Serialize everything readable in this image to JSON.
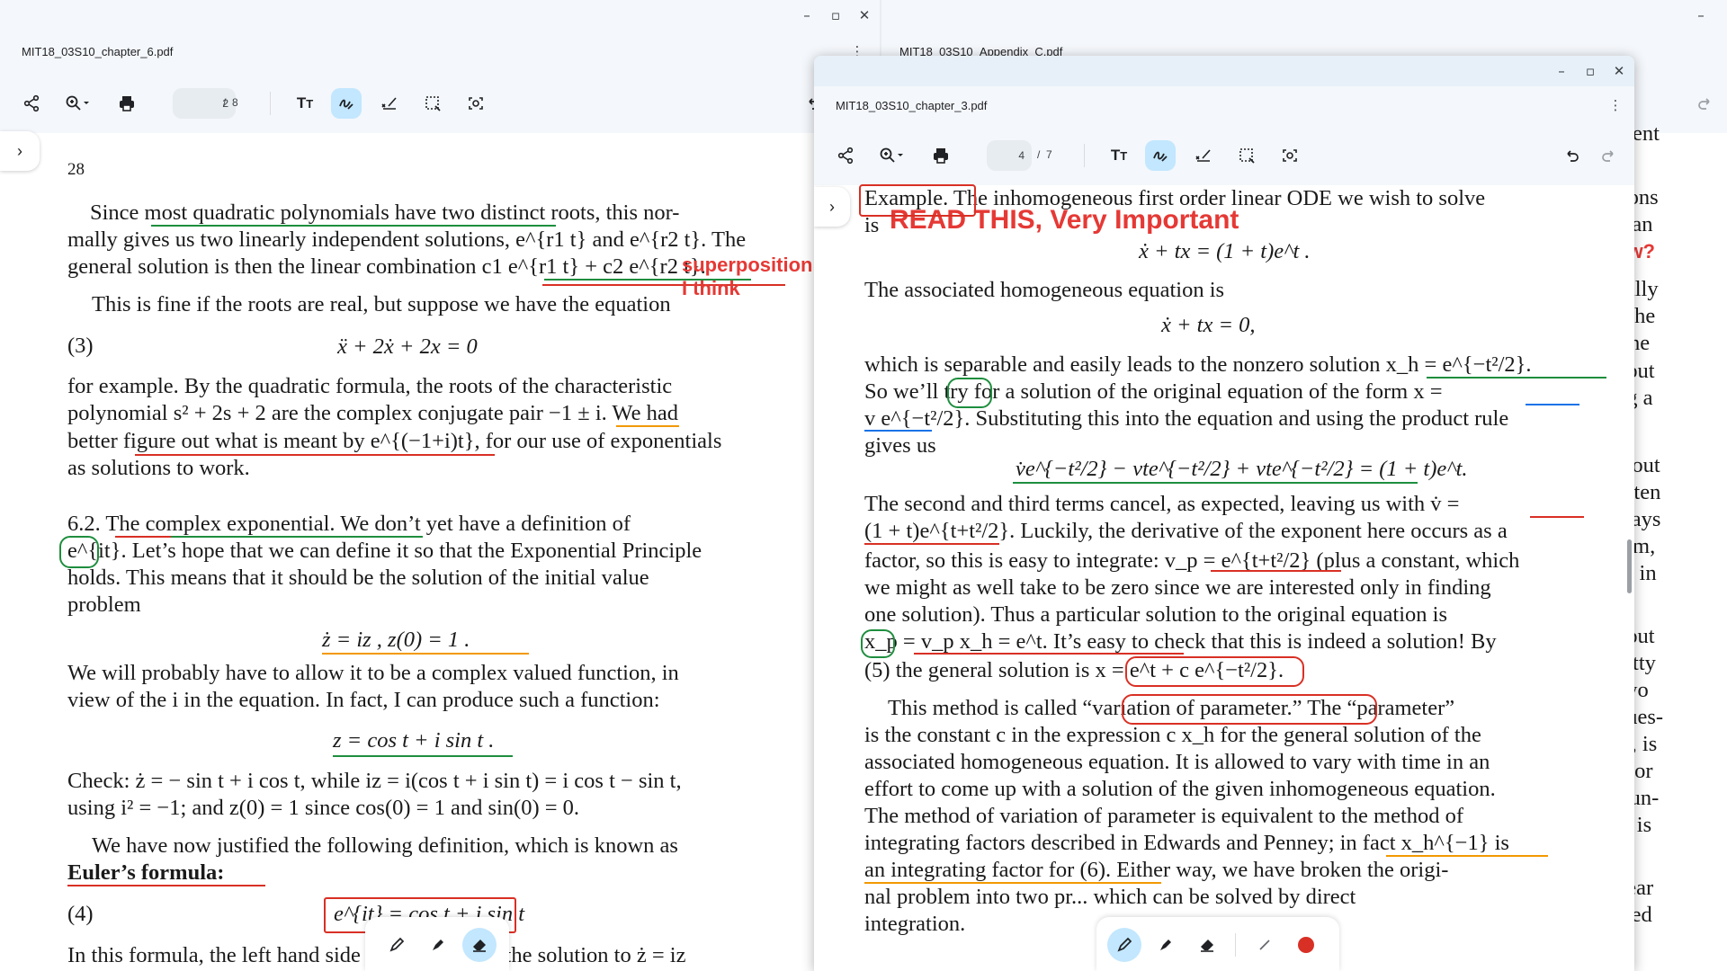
{
  "left_window": {
    "filename": "MIT18_03S10_chapter_6.pdf",
    "page_current": "2",
    "page_sep": "/",
    "page_total": "8",
    "page_number_printed": "28",
    "lines": [
      "Since most quadratic polynomials have two distinct roots, this nor-",
      "mally gives us two linearly independent solutions, e^{r1 t} and e^{r2 t}. The",
      "general solution is then the linear combination c1 e^{r1 t} + c2 e^{r2 t}.",
      "This is fine if the roots are real, but suppose we have the equation",
      "for example. By the quadratic formula, the roots of the characteristic",
      "polynomial s² + 2s + 2 are the complex conjugate pair −1 ± i. We had",
      "better figure out what is meant by e^{(−1+i)t}, for our use of exponentials",
      "as solutions to work.",
      "6.2. The complex exponential. We don’t yet have a definition of",
      "e^{it}. Let’s hope that we can define it so that the Exponential Principle",
      "holds. This means that it should be the solution of the initial value",
      "problem",
      "We will probably have to allow it to be a complex valued function, in",
      "view of the i in the equation. In fact, I can produce such a function:",
      "Check: ż = − sin t + i cos t, while iz = i(cos t + i sin t) = i cos t − sin t,",
      "using i² = −1; and z(0) = 1 since cos(0) = 1 and sin(0) = 0.",
      "We have now justified the following definition, which is known as",
      "Euler’s formula:",
      "In this formula, the left hand side is by definition the solution to ż = iz"
    ],
    "eq3_label": "(3)",
    "eq3": "ẍ + 2ẋ + 2x = 0",
    "eq_ivp": "ż = iz ,    z(0) = 1 .",
    "eq_z": "z = cos t + i sin t .",
    "eq4_label": "(4)",
    "eq4": "e^{it} = cos t + i sin t",
    "annotation_1": "superposition",
    "annotation_2": "I think"
  },
  "right_back_window": {
    "filename": "MIT18_03S10_Appendix_C.pdf",
    "edge_text": [
      "erent",
      "tions",
      "g an",
      "ow?",
      "cally",
      "f the",
      "The",
      "hout",
      "ng a",
      "k out",
      "often",
      "ways",
      "ium,",
      "as in",
      "bout",
      "retty",
      "two",
      "ques-",
      "le, is",
      "t) or",
      "s un-",
      "at is",
      "near",
      "ated"
    ]
  },
  "front_window": {
    "filename": "MIT18_03S10_chapter_3.pdf",
    "page_current": "4",
    "page_sep": "/",
    "page_total": "7",
    "annotation_read": "READ THIS, Very Important",
    "lines": [
      "Example. The inhomogeneous first order linear ODE we wish to solve",
      "is",
      "The associated homogeneous equation is",
      "which is separable and easily leads to the nonzero solution x_h = e^{−t²/2}.",
      "So we’ll try for a solution of the original equation of the form x =",
      "v e^{−t²/2}. Substituting this into the equation and using the product rule",
      "gives us",
      "The second and third terms cancel, as expected, leaving us with v̇ =",
      "(1 + t)e^{t+t²/2}. Luckily, the derivative of the exponent here occurs as a",
      "factor, so this is easy to integrate: v_p = e^{t+t²/2} (plus a constant, which",
      "we might as well take to be zero since we are interested only in finding",
      "one solution). Thus a particular solution to the original equation is",
      "x_p = v_p x_h = e^t. It’s easy to check that this is indeed a solution! By",
      "(5) the general solution is x = e^t + c e^{−t²/2}.",
      "This method is called “variation of parameter.” The “parameter”",
      "is the constant c in the expression c x_h for the general solution of the",
      "associated homogeneous equation. It is allowed to vary with time in an",
      "effort to come up with a solution of the given inhomogeneous equation.",
      "The method of variation of parameter is equivalent to the method of",
      "integrating factors described in Edwards and Penney; in fact x_h^{−1} is",
      "an integrating factor for (6). Either way, we have broken the origi-",
      "nal problem into two pr... which can be solved by direct",
      "integration."
    ],
    "eq_inhom": "ẋ + tx = (1 + t)e^t .",
    "eq_hom": "ẋ + tx = 0,",
    "eq_prod": "v̇e^{−t²/2} − vte^{−t²/2} + vte^{−t²/2} = (1 + t)e^t."
  },
  "colors": {
    "pen_red": "#d93025",
    "pen_green": "#1e8e3e",
    "pen_orange": "#f29900",
    "pen_blue": "#1a73e8",
    "active_tool": "#c2e7ff"
  },
  "icons": [
    "share-icon",
    "zoom-icon",
    "print-icon",
    "text-icon",
    "pen-icon",
    "signature-icon",
    "select-icon",
    "screenshot-icon",
    "undo-icon",
    "redo-icon",
    "more-icon"
  ]
}
